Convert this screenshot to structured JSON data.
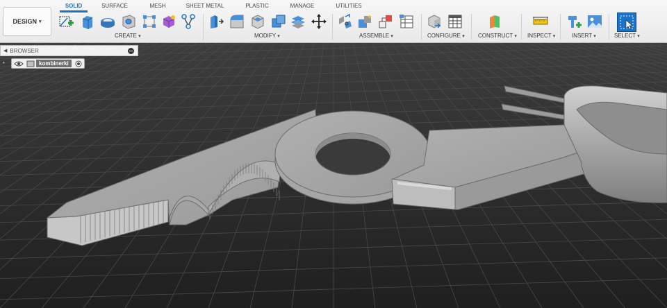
{
  "workspace": {
    "label": "DESIGN"
  },
  "tabs": [
    {
      "label": "SOLID",
      "active": true
    },
    {
      "label": "SURFACE",
      "active": false
    },
    {
      "label": "MESH",
      "active": false
    },
    {
      "label": "SHEET METAL",
      "active": false
    },
    {
      "label": "PLASTIC",
      "active": false
    },
    {
      "label": "MANAGE",
      "active": false
    },
    {
      "label": "UTILITIES",
      "active": false
    }
  ],
  "groups": {
    "create": "CREATE",
    "modify": "MODIFY",
    "assemble": "ASSEMBLE",
    "configure": "CONFIGURE",
    "construct": "CONSTRUCT",
    "inspect": "INSPECT",
    "insert": "INSERT",
    "select": "SELECT"
  },
  "icons": {
    "create": [
      "new-sketch-icon",
      "extrude-icon",
      "revolve-icon",
      "hole-icon",
      "pattern-icon",
      "form-icon",
      "automate-icon"
    ],
    "modify": [
      "press-pull-icon",
      "fillet-icon",
      "shell-icon",
      "combine-icon",
      "stack-icon",
      "move-icon"
    ],
    "assemble": [
      "joint-icon",
      "new-component-icon",
      "as-built-icon",
      "table-icon"
    ],
    "configure": [
      "configure-icon",
      "grid-table-icon"
    ],
    "construct": [
      "plane-icon"
    ],
    "inspect": [
      "measure-icon"
    ],
    "insert": [
      "insert-derive-icon",
      "insert-image-icon"
    ],
    "select": [
      "select-cursor-icon"
    ]
  },
  "browser": {
    "title": "BROWSER",
    "root_node": "kombinerki"
  },
  "colors": {
    "accent": "#1a73c7",
    "viewport_bg": "#2b2b2b",
    "model_gray": "#9d9d9d"
  }
}
